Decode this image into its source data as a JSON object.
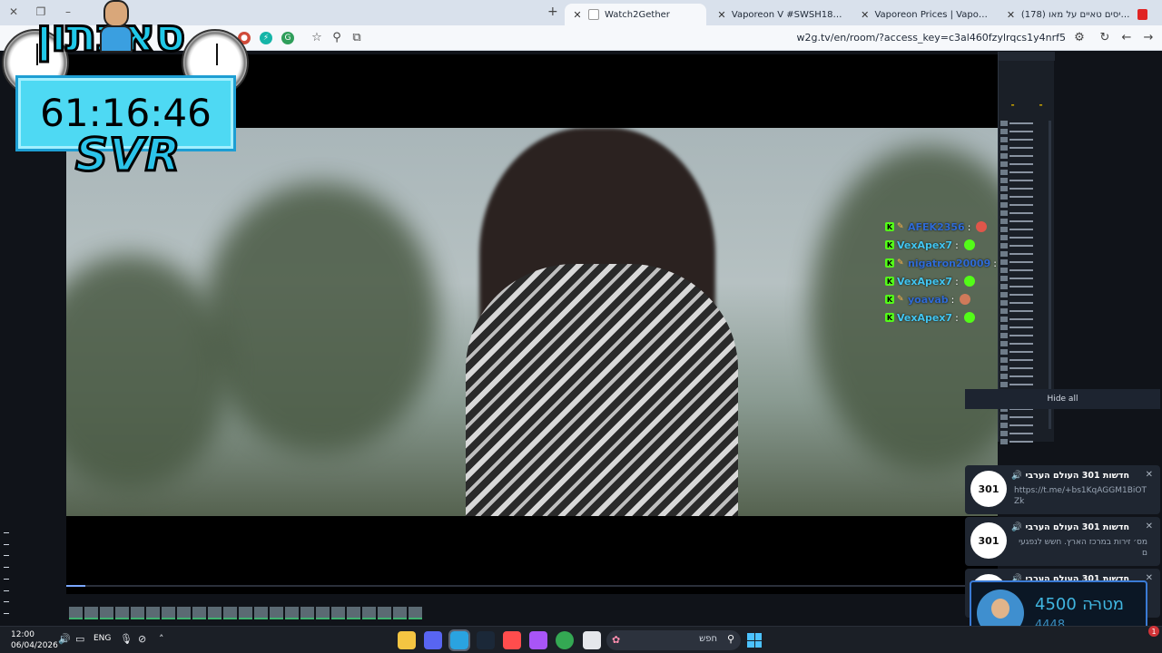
{
  "browser": {
    "tabs": [
      {
        "title": "Watch2Gether",
        "active": true
      },
      {
        "title": "Vaporeon V #SWSH181 Prices",
        "active": false
      },
      {
        "title": "Vaporeon Prices | Vaporeon List",
        "active": false
      },
      {
        "title": "(178) איתן גיסים טאיים על מאו",
        "active": false
      }
    ],
    "url": "w2g.tv/en/room/?access_key=c3al460fzylrqcs1y4nrf5"
  },
  "stream_overlay": {
    "title": "סאבתון",
    "timer": "61:16:46",
    "tag": "SVR"
  },
  "chat": [
    {
      "user": "AFEK2356",
      "color": "#2f6bd6"
    },
    {
      "user": "VexApex7",
      "color": "#42c6f2"
    },
    {
      "user": "nigatron20009",
      "color": "#2f6bd6"
    },
    {
      "user": "VexApex7",
      "color": "#42c6f2"
    },
    {
      "user": "yoavab",
      "color": "#2f6bd6"
    },
    {
      "user": "VexApex7",
      "color": "#42c6f2"
    }
  ],
  "chat_separator": ":",
  "notifications": {
    "hide_all": "Hide all",
    "items": [
      {
        "logo": "301",
        "title": "חדשות 301 העולם הערבי 🔊",
        "body": "https://t.me/+bs1KqAGGM1BiOTZk"
      },
      {
        "logo": "301",
        "title": "חדשות 301 העולם הערבי 🔊",
        "body": "מס׳ זירות במרכז הארץ. חשש לנפגעים"
      },
      {
        "logo": "301",
        "title": "חדשות 301 העולם הערבי 🔊",
        "body": ""
      }
    ]
  },
  "goal": {
    "label": "מטרה",
    "dash": "–",
    "target": "4500",
    "current": "4448",
    "progress_fraction": 0.988
  },
  "taskbar": {
    "time": "12:00",
    "date": "06/04/2026",
    "language": "ENG",
    "search_placeholder": "חפש",
    "notification_count": "1"
  },
  "colors": {
    "accent": "#40b6e0",
    "kick_green": "#53fc18"
  }
}
